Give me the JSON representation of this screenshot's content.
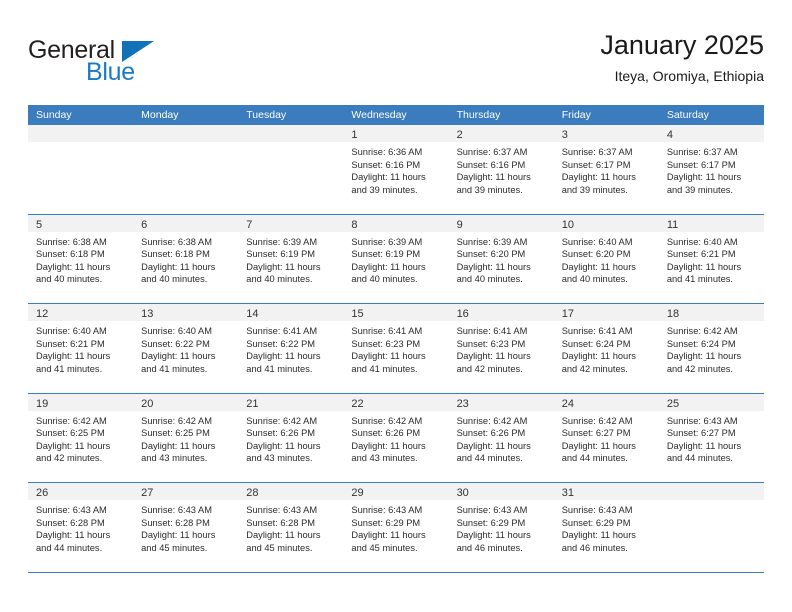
{
  "brand": {
    "name_top": "General",
    "name_bottom": "Blue",
    "triangle_icon": "triangle-logo-icon",
    "colors": {
      "dark": "#231f20",
      "blue": "#1b7ac4"
    }
  },
  "header": {
    "title": "January 2025",
    "subtitle": "Iteya, Oromiya, Ethiopia"
  },
  "theme": {
    "header_bg": "#3a7cbe",
    "header_text": "#ffffff",
    "day_band_bg": "#f2f2f2",
    "cell_bg": "#ffffff",
    "row_divider": "#3a7cbe"
  },
  "weekdays": [
    "Sunday",
    "Monday",
    "Tuesday",
    "Wednesday",
    "Thursday",
    "Friday",
    "Saturday"
  ],
  "weeks": [
    [
      {
        "day": "",
        "empty": true,
        "sunrise": "",
        "sunset": "",
        "daylight_line1": "",
        "daylight_line2": ""
      },
      {
        "day": "",
        "empty": true,
        "sunrise": "",
        "sunset": "",
        "daylight_line1": "",
        "daylight_line2": ""
      },
      {
        "day": "",
        "empty": true,
        "sunrise": "",
        "sunset": "",
        "daylight_line1": "",
        "daylight_line2": ""
      },
      {
        "day": "1",
        "empty": false,
        "sunrise": "Sunrise: 6:36 AM",
        "sunset": "Sunset: 6:16 PM",
        "daylight_line1": "Daylight: 11 hours",
        "daylight_line2": "and 39 minutes."
      },
      {
        "day": "2",
        "empty": false,
        "sunrise": "Sunrise: 6:37 AM",
        "sunset": "Sunset: 6:16 PM",
        "daylight_line1": "Daylight: 11 hours",
        "daylight_line2": "and 39 minutes."
      },
      {
        "day": "3",
        "empty": false,
        "sunrise": "Sunrise: 6:37 AM",
        "sunset": "Sunset: 6:17 PM",
        "daylight_line1": "Daylight: 11 hours",
        "daylight_line2": "and 39 minutes."
      },
      {
        "day": "4",
        "empty": false,
        "sunrise": "Sunrise: 6:37 AM",
        "sunset": "Sunset: 6:17 PM",
        "daylight_line1": "Daylight: 11 hours",
        "daylight_line2": "and 39 minutes."
      }
    ],
    [
      {
        "day": "5",
        "empty": false,
        "sunrise": "Sunrise: 6:38 AM",
        "sunset": "Sunset: 6:18 PM",
        "daylight_line1": "Daylight: 11 hours",
        "daylight_line2": "and 40 minutes."
      },
      {
        "day": "6",
        "empty": false,
        "sunrise": "Sunrise: 6:38 AM",
        "sunset": "Sunset: 6:18 PM",
        "daylight_line1": "Daylight: 11 hours",
        "daylight_line2": "and 40 minutes."
      },
      {
        "day": "7",
        "empty": false,
        "sunrise": "Sunrise: 6:39 AM",
        "sunset": "Sunset: 6:19 PM",
        "daylight_line1": "Daylight: 11 hours",
        "daylight_line2": "and 40 minutes."
      },
      {
        "day": "8",
        "empty": false,
        "sunrise": "Sunrise: 6:39 AM",
        "sunset": "Sunset: 6:19 PM",
        "daylight_line1": "Daylight: 11 hours",
        "daylight_line2": "and 40 minutes."
      },
      {
        "day": "9",
        "empty": false,
        "sunrise": "Sunrise: 6:39 AM",
        "sunset": "Sunset: 6:20 PM",
        "daylight_line1": "Daylight: 11 hours",
        "daylight_line2": "and 40 minutes."
      },
      {
        "day": "10",
        "empty": false,
        "sunrise": "Sunrise: 6:40 AM",
        "sunset": "Sunset: 6:20 PM",
        "daylight_line1": "Daylight: 11 hours",
        "daylight_line2": "and 40 minutes."
      },
      {
        "day": "11",
        "empty": false,
        "sunrise": "Sunrise: 6:40 AM",
        "sunset": "Sunset: 6:21 PM",
        "daylight_line1": "Daylight: 11 hours",
        "daylight_line2": "and 41 minutes."
      }
    ],
    [
      {
        "day": "12",
        "empty": false,
        "sunrise": "Sunrise: 6:40 AM",
        "sunset": "Sunset: 6:21 PM",
        "daylight_line1": "Daylight: 11 hours",
        "daylight_line2": "and 41 minutes."
      },
      {
        "day": "13",
        "empty": false,
        "sunrise": "Sunrise: 6:40 AM",
        "sunset": "Sunset: 6:22 PM",
        "daylight_line1": "Daylight: 11 hours",
        "daylight_line2": "and 41 minutes."
      },
      {
        "day": "14",
        "empty": false,
        "sunrise": "Sunrise: 6:41 AM",
        "sunset": "Sunset: 6:22 PM",
        "daylight_line1": "Daylight: 11 hours",
        "daylight_line2": "and 41 minutes."
      },
      {
        "day": "15",
        "empty": false,
        "sunrise": "Sunrise: 6:41 AM",
        "sunset": "Sunset: 6:23 PM",
        "daylight_line1": "Daylight: 11 hours",
        "daylight_line2": "and 41 minutes."
      },
      {
        "day": "16",
        "empty": false,
        "sunrise": "Sunrise: 6:41 AM",
        "sunset": "Sunset: 6:23 PM",
        "daylight_line1": "Daylight: 11 hours",
        "daylight_line2": "and 42 minutes."
      },
      {
        "day": "17",
        "empty": false,
        "sunrise": "Sunrise: 6:41 AM",
        "sunset": "Sunset: 6:24 PM",
        "daylight_line1": "Daylight: 11 hours",
        "daylight_line2": "and 42 minutes."
      },
      {
        "day": "18",
        "empty": false,
        "sunrise": "Sunrise: 6:42 AM",
        "sunset": "Sunset: 6:24 PM",
        "daylight_line1": "Daylight: 11 hours",
        "daylight_line2": "and 42 minutes."
      }
    ],
    [
      {
        "day": "19",
        "empty": false,
        "sunrise": "Sunrise: 6:42 AM",
        "sunset": "Sunset: 6:25 PM",
        "daylight_line1": "Daylight: 11 hours",
        "daylight_line2": "and 42 minutes."
      },
      {
        "day": "20",
        "empty": false,
        "sunrise": "Sunrise: 6:42 AM",
        "sunset": "Sunset: 6:25 PM",
        "daylight_line1": "Daylight: 11 hours",
        "daylight_line2": "and 43 minutes."
      },
      {
        "day": "21",
        "empty": false,
        "sunrise": "Sunrise: 6:42 AM",
        "sunset": "Sunset: 6:26 PM",
        "daylight_line1": "Daylight: 11 hours",
        "daylight_line2": "and 43 minutes."
      },
      {
        "day": "22",
        "empty": false,
        "sunrise": "Sunrise: 6:42 AM",
        "sunset": "Sunset: 6:26 PM",
        "daylight_line1": "Daylight: 11 hours",
        "daylight_line2": "and 43 minutes."
      },
      {
        "day": "23",
        "empty": false,
        "sunrise": "Sunrise: 6:42 AM",
        "sunset": "Sunset: 6:26 PM",
        "daylight_line1": "Daylight: 11 hours",
        "daylight_line2": "and 44 minutes."
      },
      {
        "day": "24",
        "empty": false,
        "sunrise": "Sunrise: 6:42 AM",
        "sunset": "Sunset: 6:27 PM",
        "daylight_line1": "Daylight: 11 hours",
        "daylight_line2": "and 44 minutes."
      },
      {
        "day": "25",
        "empty": false,
        "sunrise": "Sunrise: 6:43 AM",
        "sunset": "Sunset: 6:27 PM",
        "daylight_line1": "Daylight: 11 hours",
        "daylight_line2": "and 44 minutes."
      }
    ],
    [
      {
        "day": "26",
        "empty": false,
        "sunrise": "Sunrise: 6:43 AM",
        "sunset": "Sunset: 6:28 PM",
        "daylight_line1": "Daylight: 11 hours",
        "daylight_line2": "and 44 minutes."
      },
      {
        "day": "27",
        "empty": false,
        "sunrise": "Sunrise: 6:43 AM",
        "sunset": "Sunset: 6:28 PM",
        "daylight_line1": "Daylight: 11 hours",
        "daylight_line2": "and 45 minutes."
      },
      {
        "day": "28",
        "empty": false,
        "sunrise": "Sunrise: 6:43 AM",
        "sunset": "Sunset: 6:28 PM",
        "daylight_line1": "Daylight: 11 hours",
        "daylight_line2": "and 45 minutes."
      },
      {
        "day": "29",
        "empty": false,
        "sunrise": "Sunrise: 6:43 AM",
        "sunset": "Sunset: 6:29 PM",
        "daylight_line1": "Daylight: 11 hours",
        "daylight_line2": "and 45 minutes."
      },
      {
        "day": "30",
        "empty": false,
        "sunrise": "Sunrise: 6:43 AM",
        "sunset": "Sunset: 6:29 PM",
        "daylight_line1": "Daylight: 11 hours",
        "daylight_line2": "and 46 minutes."
      },
      {
        "day": "31",
        "empty": false,
        "sunrise": "Sunrise: 6:43 AM",
        "sunset": "Sunset: 6:29 PM",
        "daylight_line1": "Daylight: 11 hours",
        "daylight_line2": "and 46 minutes."
      },
      {
        "day": "",
        "empty": true,
        "sunrise": "",
        "sunset": "",
        "daylight_line1": "",
        "daylight_line2": ""
      }
    ]
  ]
}
